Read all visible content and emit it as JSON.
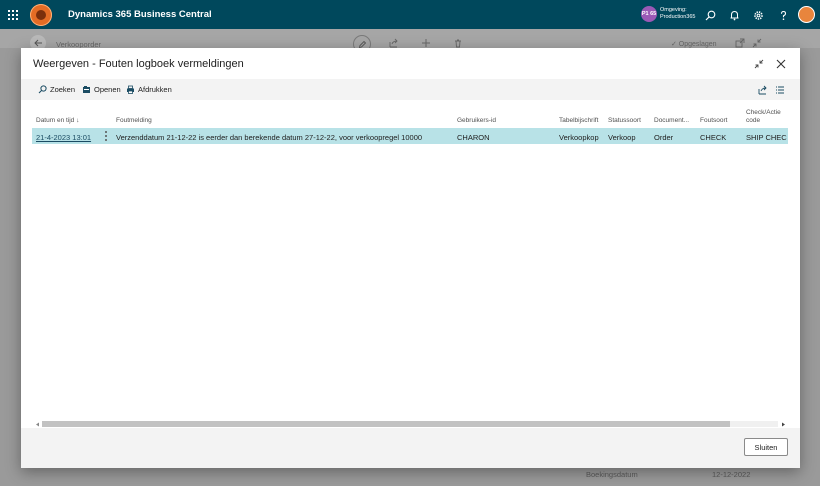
{
  "topbar": {
    "app_title": "Dynamics 365 Business Central",
    "env_badge": "P1 65",
    "env_label": "Omgeving:",
    "env_name": "Production365",
    "icons": [
      "waffle-icon",
      "app-logo",
      "search-icon",
      "bell-icon",
      "gear-icon",
      "help-icon",
      "avatar"
    ]
  },
  "background_page": {
    "title": "Verkooporder",
    "saved_label": "✓ Opgeslagen",
    "field_label": "Boekingsdatum",
    "field_value": "12-12-2022"
  },
  "dialog": {
    "title": "Weergeven - Fouten logboek vermeldingen",
    "actions": {
      "search": "Zoeken",
      "open": "Openen",
      "print": "Afdrukken"
    },
    "columns": {
      "datetime": "Datum en tijd ↓",
      "message": "Foutmelding",
      "user": "Gebruikers-id",
      "table": "Tabelbijschrift",
      "status_type": "Statussoort",
      "document": "Document...",
      "error_type": "Foutsoort",
      "check_action_1": "Check/Actie",
      "check_action_2": "code"
    },
    "rows": [
      {
        "datetime": "21-4-2023 13:01",
        "message": "Verzenddatum 21-12-22 is eerder dan berekende datum 27-12-22, voor verkoopregel 10000",
        "user": "CHARON",
        "table": "Verkoopkop",
        "status_type": "Verkoop",
        "document": "Order",
        "error_type": "CHECK",
        "check_action": "SHIP CHECK"
      }
    ],
    "close_button": "Sluiten"
  },
  "colors": {
    "topbar": "#00485c",
    "selected_row": "#b8e2e7",
    "accent": "#e36c25"
  }
}
